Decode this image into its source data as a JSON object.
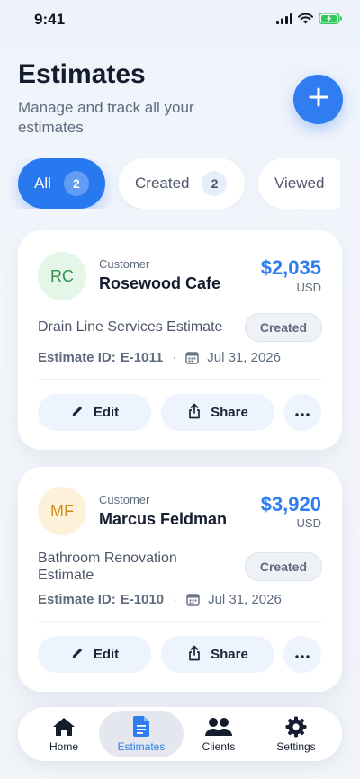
{
  "status_bar": {
    "time": "9:41"
  },
  "header": {
    "title": "Estimates",
    "subtitle": "Manage and track all your estimates"
  },
  "filters": [
    {
      "label": "All",
      "count": "2",
      "active": true
    },
    {
      "label": "Created",
      "count": "2",
      "active": false
    },
    {
      "label": "Viewed",
      "active": false
    }
  ],
  "estimates": [
    {
      "initials": "RC",
      "customer_label": "Customer",
      "customer": "Rosewood Cafe",
      "amount": "$2,035",
      "currency": "USD",
      "title": "Drain Line Services Estimate",
      "status": "Created",
      "id_label": "Estimate ID:",
      "id": "E-1011",
      "date": "Jul 31, 2026",
      "edit_label": "Edit",
      "share_label": "Share",
      "avatar_bg": "#e3f6e8",
      "avatar_fg": "#2f8f4a"
    },
    {
      "initials": "MF",
      "customer_label": "Customer",
      "customer": "Marcus Feldman",
      "amount": "$3,920",
      "currency": "USD",
      "title": "Bathroom Renovation Estimate",
      "status": "Created",
      "id_label": "Estimate ID:",
      "id": "E-1010",
      "date": "Jul 31, 2026",
      "edit_label": "Edit",
      "share_label": "Share",
      "avatar_bg": "#fdf1d9",
      "avatar_fg": "#c9901c"
    }
  ],
  "tabbar": [
    {
      "label": "Home",
      "icon": "home-icon",
      "active": false
    },
    {
      "label": "Estimates",
      "icon": "document-icon",
      "active": true
    },
    {
      "label": "Clients",
      "icon": "users-icon",
      "active": false
    },
    {
      "label": "Settings",
      "icon": "gear-icon",
      "active": false
    }
  ],
  "colors": {
    "accent": "#2f7df0",
    "text": "#141c2e",
    "muted": "#5f6b7e"
  }
}
